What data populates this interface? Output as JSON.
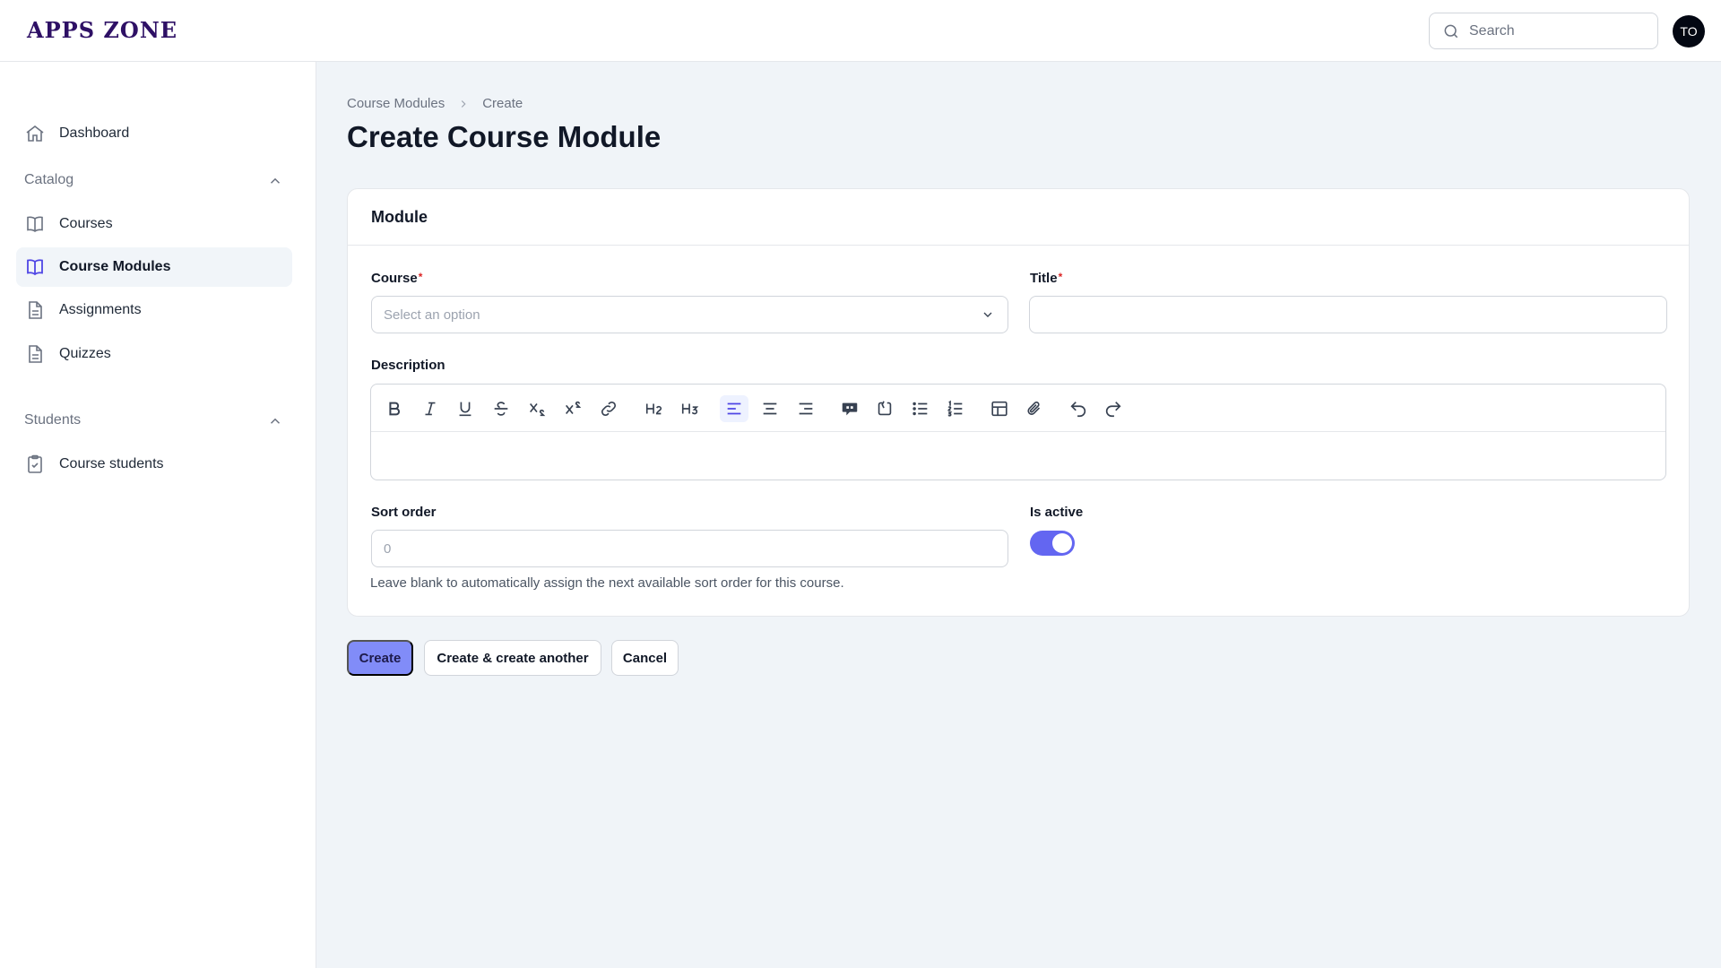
{
  "app": {
    "logo": "APPS ZONE"
  },
  "search": {
    "placeholder": "Search"
  },
  "user": {
    "initials": "TO"
  },
  "sidebar": {
    "dashboard": "Dashboard",
    "groups": [
      {
        "label": "Catalog",
        "items": [
          "Courses",
          "Course Modules",
          "Assignments",
          "Quizzes"
        ]
      },
      {
        "label": "Students",
        "items": [
          "Course students"
        ]
      }
    ],
    "active_item": "Course Modules"
  },
  "breadcrumb": {
    "parent": "Course Modules",
    "current": "Create"
  },
  "page": {
    "title": "Create Course Module"
  },
  "form": {
    "section_title": "Module",
    "course": {
      "label": "Course",
      "required_mark": "*",
      "placeholder": "Select an option"
    },
    "title": {
      "label": "Title",
      "required_mark": "*",
      "value": ""
    },
    "description": {
      "label": "Description",
      "value": ""
    },
    "sort_order": {
      "label": "Sort order",
      "placeholder": "0",
      "help": "Leave blank to automatically assign the next available sort order for this course."
    },
    "is_active": {
      "label": "Is active",
      "checked": true
    }
  },
  "toolbar_icons": [
    "bold-icon",
    "italic-icon",
    "underline-icon",
    "strikethrough-icon",
    "subscript-icon",
    "superscript-icon",
    "link-icon",
    "heading-2-icon",
    "heading-3-icon",
    "align-left-icon",
    "align-center-icon",
    "align-right-icon",
    "blockquote-icon",
    "code-block-icon",
    "bullet-list-icon",
    "ordered-list-icon",
    "table-icon",
    "attach-icon",
    "undo-icon",
    "redo-icon"
  ],
  "actions": {
    "create": "Create",
    "create_another": "Create & create another",
    "cancel": "Cancel"
  },
  "colors": {
    "primary": "#818cf8",
    "toggle_on": "#6366f1",
    "logo": "#2e1065",
    "required": "#dc2626"
  }
}
